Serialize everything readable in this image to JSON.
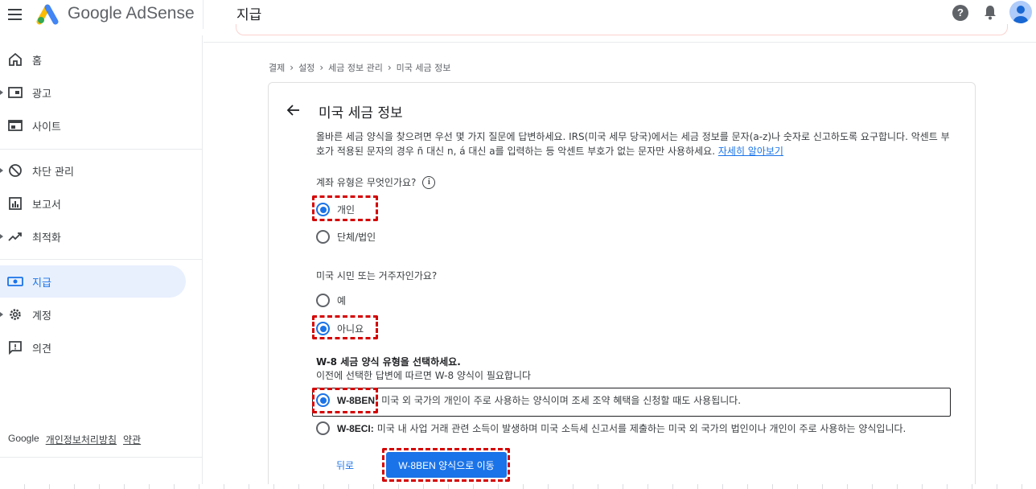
{
  "app": {
    "brand": "Google AdSense",
    "page_title": "지급"
  },
  "header": {
    "help_icon": "help-icon",
    "notification_icon": "bell-icon"
  },
  "sidebar": {
    "items": [
      {
        "label": "홈",
        "icon": "home-icon"
      },
      {
        "label": "광고",
        "icon": "ads-icon"
      },
      {
        "label": "사이트",
        "icon": "sites-icon"
      },
      {
        "label": "차단 관리",
        "icon": "block-icon"
      },
      {
        "label": "보고서",
        "icon": "reports-icon"
      },
      {
        "label": "최적화",
        "icon": "trending-icon"
      },
      {
        "label": "지급",
        "icon": "payments-icon",
        "active": true
      },
      {
        "label": "계정",
        "icon": "gear-icon"
      },
      {
        "label": "의견",
        "icon": "feedback-icon"
      }
    ],
    "footer": {
      "brand": "Google",
      "privacy": "개인정보처리방침",
      "terms": "약관"
    }
  },
  "breadcrumb": [
    "결제",
    "설정",
    "세금 정보 관리",
    "미국 세금 정보"
  ],
  "form": {
    "title": "미국 세금 정보",
    "intro": "올바른 세금 양식을 찾으려면 우선 몇 가지 질문에 답변하세요. IRS(미국 세무 당국)에서는 세금 정보를 문자(a-z)나 숫자로 신고하도록 요구합니다. 악센트 부호가 적용된 문자의 경우 ñ 대신 n, á 대신 a를 입력하는 등 악센트 부호가 없는 문자만 사용하세요.",
    "learn_more": "자세히 알아보기",
    "q1": {
      "label": "계좌 유형은 무엇인가요?",
      "options": [
        "개인",
        "단체/법인"
      ],
      "selected": "개인"
    },
    "q2": {
      "label": "미국 시민 또는 거주자인가요?",
      "options": [
        "예",
        "아니요"
      ],
      "selected": "아니요"
    },
    "w8": {
      "title": "W-8 세금 양식 유형을 선택하세요.",
      "subtitle": "이전에 선택한 답변에 따르면 W-8 양식이 필요합니다",
      "options": [
        {
          "code": "W-8BEN:",
          "desc": "미국 외 국가의 개인이 주로 사용하는 양식이며 조세 조약 혜택을 신청할 때도 사용됩니다."
        },
        {
          "code": "W-8ECI:",
          "desc": "미국 내 사업 거래 관련 소득이 발생하며 미국 소득세 신고서를 제출하는 미국 외 국가의 법인이나 개인이 주로 사용하는 양식입니다."
        }
      ],
      "selected": "W-8BEN:"
    },
    "back_label": "뒤로",
    "submit_label": "W-8BEN 양식으로 이동"
  },
  "colors": {
    "accent": "#1a73e8",
    "highlight": "#d50000"
  }
}
